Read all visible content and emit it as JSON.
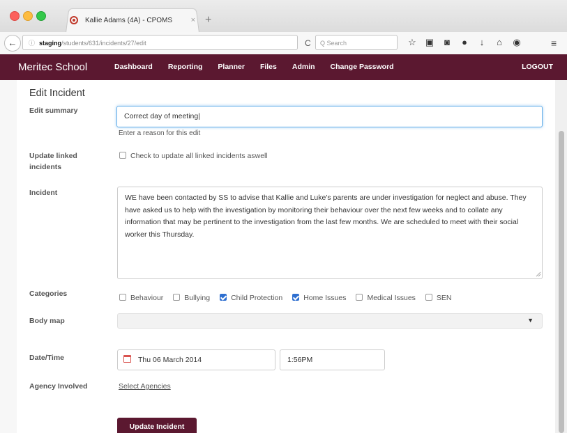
{
  "browser": {
    "tab_title": "Kallie Adams (4A) - CPOMS",
    "tab_close": "×",
    "new_tab": "+",
    "back": "←",
    "url_info": "ⓘ",
    "url_host": "staging",
    "url_path": "/students/631/incidents/27/edit",
    "reload": "C",
    "search_placeholder": "Q  Search",
    "toolbar_icons": [
      "star-icon",
      "clipboard-icon",
      "pocket-icon",
      "sync-icon",
      "download-icon",
      "home-icon",
      "chat-icon"
    ],
    "menu": "≡"
  },
  "site": {
    "brand": "Meritec School",
    "nav": [
      "Dashboard",
      "Reporting",
      "Planner",
      "Files",
      "Admin",
      "Change Password"
    ],
    "logout": "LOGOUT",
    "accent_color": "#5b1830"
  },
  "form": {
    "title": "Edit Incident",
    "edit_summary_label": "Edit summary",
    "edit_summary_value": "Correct day of meeting|",
    "edit_summary_help": "Enter a reason for this edit",
    "update_linked_label": "Update linked incidents",
    "update_linked_text": "Check to update all linked incidents aswell",
    "update_linked_checked": false,
    "incident_label": "Incident",
    "incident_text": "WE have been contacted by SS to advise that Kallie and Luke's parents are under investigation for neglect and abuse. They have asked us to help with the investigation by monitoring their behaviour over the next few weeks and to collate any information that may be pertinent to the investigation from the last few months. We are scheduled to meet with their social worker this Thursday.",
    "categories_label": "Categories",
    "categories": [
      {
        "label": "Behaviour",
        "checked": false
      },
      {
        "label": "Bullying",
        "checked": false
      },
      {
        "label": "Child Protection",
        "checked": true
      },
      {
        "label": "Home Issues",
        "checked": true
      },
      {
        "label": "Medical Issues",
        "checked": false
      },
      {
        "label": "SEN",
        "checked": false
      }
    ],
    "body_map_label": "Body map",
    "body_map_value": "",
    "datetime_label": "Date/Time",
    "date_value": "Thu 06 March 2014",
    "time_value": "1:56PM",
    "agency_label": "Agency Involved",
    "agency_link": "Select Agencies",
    "submit_label": "Update Incident"
  }
}
